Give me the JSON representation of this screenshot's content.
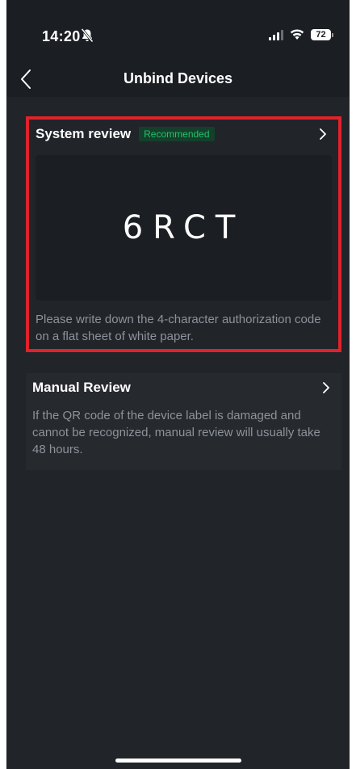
{
  "status_bar": {
    "time": "14:20",
    "battery": "72"
  },
  "nav": {
    "title": "Unbind Devices"
  },
  "system_review": {
    "title": "System review",
    "badge": "Recommended",
    "code": "6RCT",
    "description": "Please write down the 4-character authorization code on a flat sheet of white paper."
  },
  "manual_review": {
    "title": "Manual Review",
    "description": "If the QR code of the device label is damaged and cannot be recognized, manual review will usually take 48 hours."
  },
  "colors": {
    "background": "#212429",
    "header": "#1b1e22",
    "highlight_border": "#e0222a",
    "badge_text": "#22c16a",
    "badge_bg": "#14402b",
    "muted_text": "#8d939b"
  },
  "icons": {
    "back": "chevron-left-icon",
    "silent": "bell-slash-icon",
    "signal": "cellular-signal-icon",
    "wifi": "wifi-icon",
    "battery": "battery-icon",
    "chevron": "chevron-right-icon"
  }
}
